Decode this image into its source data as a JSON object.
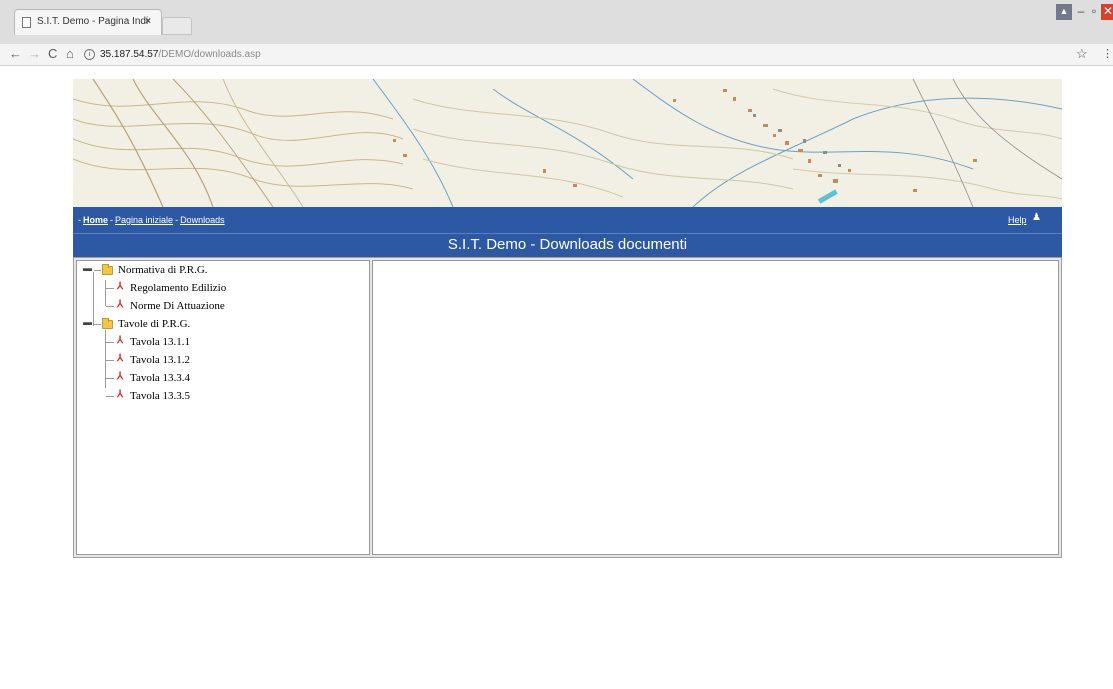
{
  "browser": {
    "tab_title": "S.I.T. Demo - Pagina Indi",
    "tab_close": "×",
    "url_host": "35.187.54.57",
    "url_path": "/DEMO/downloads.asp",
    "info_icon": "i"
  },
  "page": {
    "breadcrumb": {
      "home": "Home",
      "pagina_iniziale": "Pagina iniziale",
      "downloads": "Downloads",
      "separator": "-"
    },
    "help_label": "Help",
    "title": "S.I.T. Demo - Downloads documenti"
  },
  "tree": {
    "folders": [
      {
        "label": "Normativa di P.R.G.",
        "items": [
          "Regolamento Edilizio",
          "Norme Di Attuazione"
        ]
      },
      {
        "label": "Tavole di P.R.G.",
        "items": [
          "Tavola 13.1.1",
          "Tavola 13.1.2",
          "Tavola 13.3.4",
          "Tavola 13.3.5"
        ]
      }
    ]
  },
  "colors": {
    "header_blue": "#2d59a4",
    "pdf_red": "#d32b1e",
    "folder_yellow": "#f0c64c"
  },
  "icons": {
    "back": "back-arrow-icon",
    "forward": "forward-arrow-icon",
    "reload": "reload-icon",
    "home": "home-icon",
    "bookmark": "star-icon",
    "menu": "kebab-menu-icon",
    "folder": "folder-icon",
    "document": "pdf-icon",
    "help": "user-icon"
  }
}
